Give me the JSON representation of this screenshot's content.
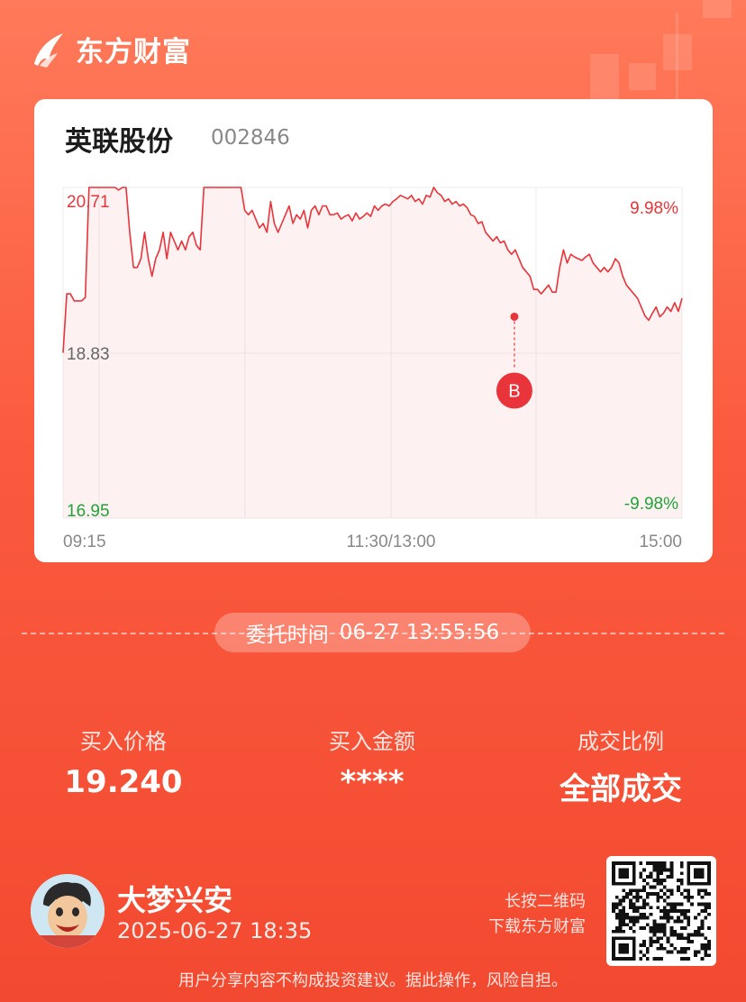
{
  "brand": {
    "name": "东方财富"
  },
  "stock": {
    "name": "英联股份",
    "code": "002846"
  },
  "chart_data": {
    "type": "line",
    "price_labels": {
      "high": "20.71",
      "base": "18.83",
      "low": "16.95"
    },
    "pct_labels": {
      "high": "9.98%",
      "low": "-9.98%"
    },
    "time_labels": [
      "09:15",
      "11:30/13:00",
      "15:00"
    ],
    "ylim": [
      16.95,
      20.71
    ],
    "base_price": 18.83,
    "marker": {
      "label": "B",
      "price": 19.24,
      "time": "13:55"
    },
    "series": [
      {
        "values": [
          18.83,
          19.5,
          19.5,
          19.42,
          19.42,
          19.42,
          19.46,
          20.71,
          20.71,
          20.71,
          20.71,
          20.71,
          20.71,
          20.71,
          20.71,
          20.68,
          20.71,
          20.71,
          20.2,
          19.8,
          19.8,
          19.9,
          20.2,
          19.9,
          19.7,
          19.9,
          20.0,
          20.2,
          19.9,
          20.2,
          20.1,
          20.0,
          20.1,
          20.0,
          20.15,
          20.2,
          20.05,
          20.0,
          20.71,
          20.71,
          20.71,
          20.71,
          20.71,
          20.71,
          20.71,
          20.71,
          20.71,
          20.71,
          20.71,
          20.45,
          20.4,
          20.45,
          20.35,
          20.25,
          20.3,
          20.2,
          20.55,
          20.3,
          20.2,
          20.3,
          20.4,
          20.5,
          20.3,
          20.4,
          20.35,
          20.45,
          20.25,
          20.45,
          20.5,
          20.4,
          20.5,
          20.5,
          20.4,
          20.4,
          20.42,
          20.35,
          20.38,
          20.4,
          20.33,
          20.42,
          20.35,
          20.38,
          20.42,
          20.38,
          20.5,
          20.45,
          20.5,
          20.52,
          20.5,
          20.55,
          20.58,
          20.62,
          20.6,
          20.58,
          20.62,
          20.55,
          20.58,
          20.52,
          20.62,
          20.6,
          20.71,
          20.65,
          20.62,
          20.55,
          20.58,
          20.52,
          20.55,
          20.5,
          20.52,
          20.48,
          20.4,
          20.38,
          20.3,
          20.32,
          20.2,
          20.15,
          20.1,
          20.15,
          20.08,
          20.1,
          20.0,
          19.95,
          20.0,
          19.9,
          19.8,
          19.75,
          19.7,
          19.55,
          19.55,
          19.5,
          19.55,
          19.6,
          19.52,
          19.52,
          19.8,
          20.0,
          19.85,
          19.95,
          19.92,
          19.9,
          19.88,
          19.92,
          19.95,
          19.85,
          19.8,
          19.75,
          19.8,
          19.75,
          19.8,
          19.9,
          19.85,
          19.7,
          19.6,
          19.55,
          19.5,
          19.45,
          19.35,
          19.25,
          19.2,
          19.28,
          19.35,
          19.24,
          19.28,
          19.35,
          19.3,
          19.4,
          19.3,
          19.45
        ]
      }
    ]
  },
  "order": {
    "time_label": "委托时间",
    "time_value": "06-27 13:55:56"
  },
  "stats": [
    {
      "label": "买入价格",
      "value": "19.240"
    },
    {
      "label": "买入金额",
      "value": "****"
    },
    {
      "label": "成交比例",
      "value": "全部成交"
    }
  ],
  "user": {
    "name": "大梦兴安",
    "date": "2025-06-27 18:35"
  },
  "qr": {
    "hint_line1": "长按二维码",
    "hint_line2": "下载东方财富"
  },
  "disclaimer": "用户分享内容不构成投资建议。据此操作，风险自担。",
  "colors": {
    "up": "#e8343a",
    "down": "#22a339",
    "accent": "#f24a30"
  }
}
